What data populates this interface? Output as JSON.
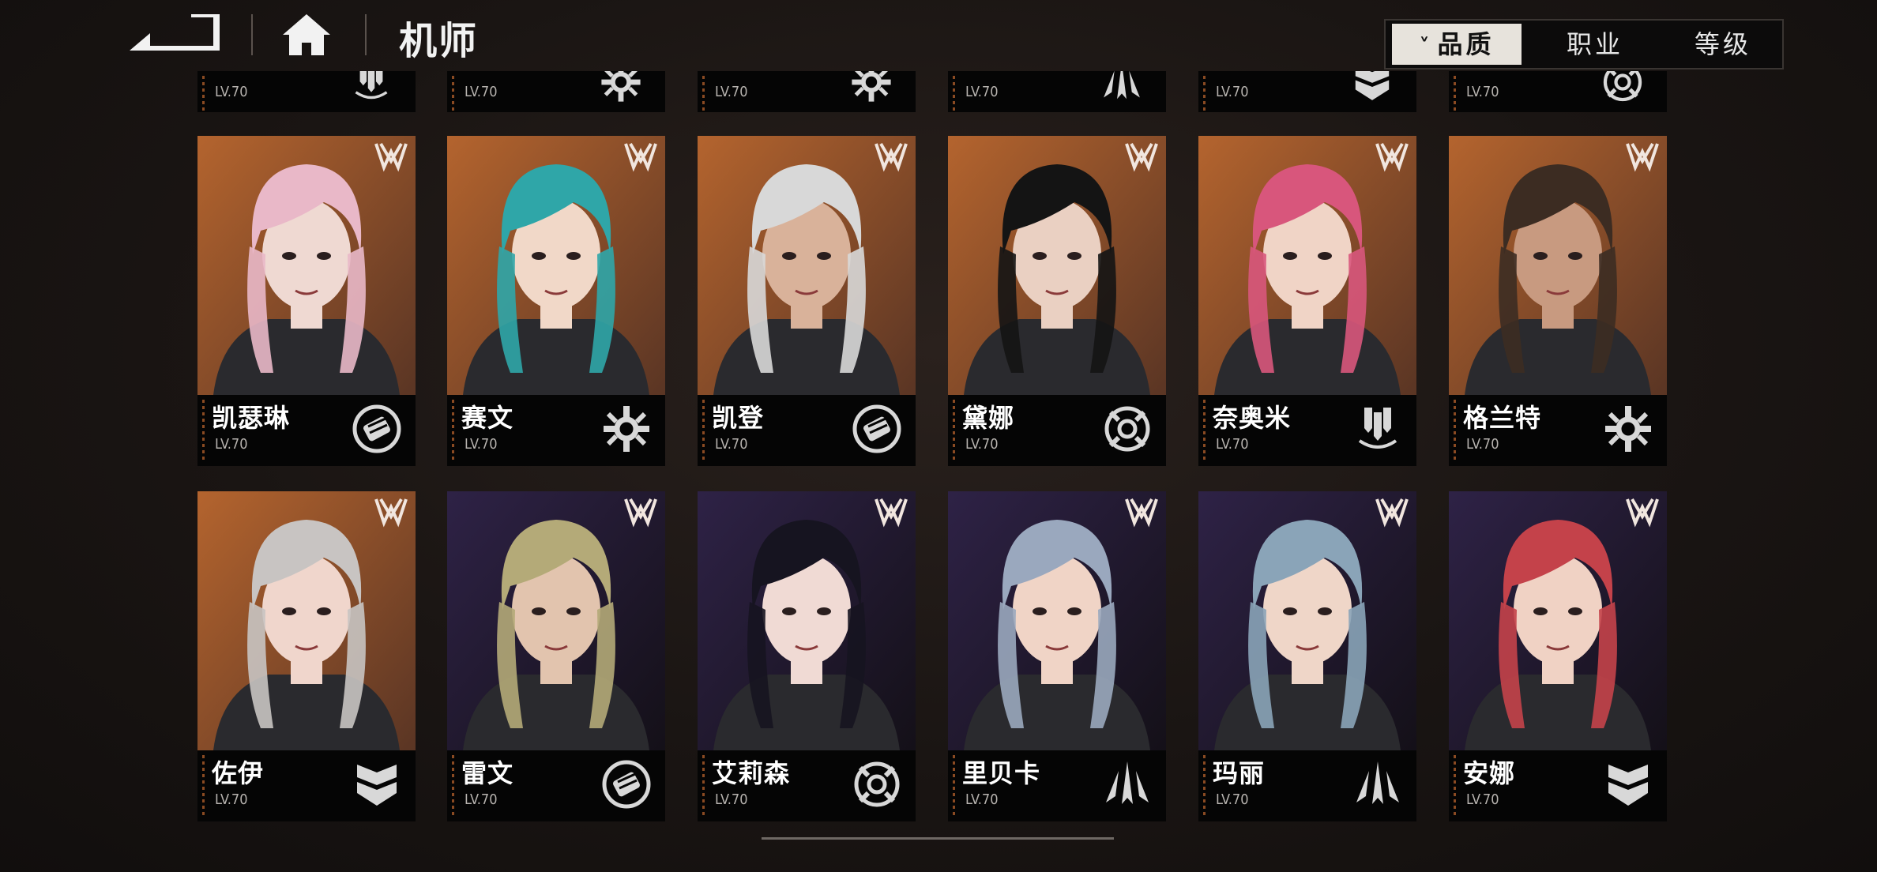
{
  "header": {
    "title": "机师",
    "back_icon": "back-arrow-icon",
    "home_icon": "home-icon"
  },
  "sort": {
    "options": [
      {
        "label": "品质",
        "active": true,
        "icon": "chevron-down-icon"
      },
      {
        "label": "职业",
        "active": false
      },
      {
        "label": "等级",
        "active": false
      }
    ]
  },
  "colors": {
    "orange_bg": "#b4642e",
    "purple_bg": "#2e2246",
    "accent_stripe": "#8a4a22"
  },
  "top_row_partial": [
    {
      "level": "LV.70",
      "class_icon": "marksman-class-icon"
    },
    {
      "level": "LV.70",
      "class_icon": "engineer-class-icon"
    },
    {
      "level": "LV.70",
      "class_icon": "engineer-class-icon"
    },
    {
      "level": "LV.70",
      "class_icon": "assault-class-icon"
    },
    {
      "level": "LV.70",
      "class_icon": "defender-class-icon"
    },
    {
      "level": "LV.70",
      "class_icon": "sniper-class-icon"
    }
  ],
  "pilots": [
    {
      "name": "凯瑟琳",
      "level": "LV.70",
      "class_icon": "fist-class-icon",
      "bg": "orange",
      "hair": "#e9b8c8",
      "skin": "#efd9d2"
    },
    {
      "name": "赛文",
      "level": "LV.70",
      "class_icon": "engineer-class-icon",
      "bg": "orange",
      "hair": "#2fa6a8",
      "skin": "#f1d8c8"
    },
    {
      "name": "凯登",
      "level": "LV.70",
      "class_icon": "fist-class-icon",
      "bg": "orange",
      "hair": "#d8d8d8",
      "skin": "#d9b29a"
    },
    {
      "name": "黛娜",
      "level": "LV.70",
      "class_icon": "sniper-class-icon",
      "bg": "orange",
      "hair": "#141414",
      "skin": "#ead0c2"
    },
    {
      "name": "奈奥米",
      "level": "LV.70",
      "class_icon": "marksman-class-icon",
      "bg": "orange",
      "hair": "#d8567c",
      "skin": "#f0d4c6"
    },
    {
      "name": "格兰特",
      "level": "LV.70",
      "class_icon": "engineer-class-icon",
      "bg": "orange",
      "hair": "#3c2c22",
      "skin": "#c89a80"
    },
    {
      "name": "佐伊",
      "level": "LV.70",
      "class_icon": "defender-class-icon",
      "bg": "orange",
      "hair": "#c8c4c2",
      "skin": "#f0d6cc"
    },
    {
      "name": "雷文",
      "level": "LV.70",
      "class_icon": "fist-class-icon",
      "bg": "purple",
      "hair": "#b4aa78",
      "skin": "#e2c4ae"
    },
    {
      "name": "艾莉森",
      "level": "LV.70",
      "class_icon": "sniper-class-icon",
      "bg": "purple",
      "hair": "#161420",
      "skin": "#f0dad4"
    },
    {
      "name": "里贝卡",
      "level": "LV.70",
      "class_icon": "assault-class-icon",
      "bg": "purple",
      "hair": "#9aa8be",
      "skin": "#f0d4c6"
    },
    {
      "name": "玛丽",
      "level": "LV.70",
      "class_icon": "assault-class-icon",
      "bg": "purple",
      "hair": "#8aa4b8",
      "skin": "#efd6c8"
    },
    {
      "name": "安娜",
      "level": "LV.70",
      "class_icon": "defender-class-icon",
      "bg": "purple",
      "hair": "#c4424a",
      "skin": "#f0d2c4"
    }
  ]
}
